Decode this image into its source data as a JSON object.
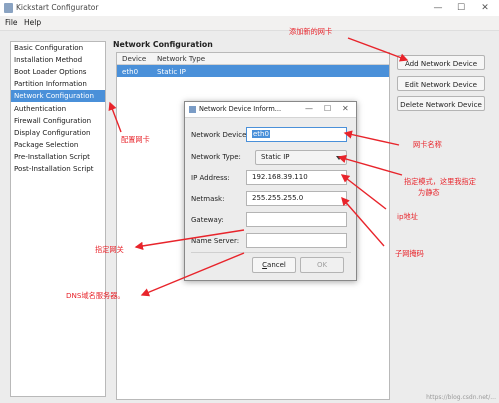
{
  "window": {
    "title": "Kickstart Configurator",
    "min_symbol": "—",
    "max_symbol": "☐",
    "close_symbol": "✕",
    "app_icon": "kickstart-icon"
  },
  "menubar": {
    "items": [
      "File",
      "Help"
    ]
  },
  "sidebar": {
    "items": [
      {
        "label": "Basic Configuration"
      },
      {
        "label": "Installation Method"
      },
      {
        "label": "Boot Loader Options"
      },
      {
        "label": "Partition Information"
      },
      {
        "label": "Network Configuration"
      },
      {
        "label": "Authentication"
      },
      {
        "label": "Firewall Configuration"
      },
      {
        "label": "Display Configuration"
      },
      {
        "label": "Package Selection"
      },
      {
        "label": "Pre-Installation Script"
      },
      {
        "label": "Post-Installation Script"
      }
    ],
    "selected_index": 4
  },
  "network": {
    "section_title": "Network Configuration",
    "columns": [
      "Device",
      "Network Type"
    ],
    "rows": [
      {
        "device": "eth0",
        "type": "Static IP"
      }
    ],
    "buttons": {
      "add": "Add Network Device",
      "edit": "Edit Network Device",
      "delete": "Delete Network Device"
    }
  },
  "dialog": {
    "title": "Network Device Inform...",
    "device_label": "Network Device:",
    "device_value": "eth0",
    "type_label": "Network Type:",
    "type_value": "Static IP",
    "ip_label": "IP Address:",
    "ip_value": "192.168.39.110",
    "netmask_label": "Netmask:",
    "netmask_value": "255.255.255.0",
    "gateway_label": "Gateway:",
    "gateway_value": "",
    "nameserver_label": "Name Server:",
    "nameserver_value": "",
    "cancel_mnemonic": "C",
    "cancel_rest": "ancel",
    "ok_label": "OK",
    "min_symbol": "—",
    "max_symbol": "☐",
    "close_symbol": "✕"
  },
  "annotations": {
    "add_nic": "添加新的网卡",
    "configure_nic": "配置网卡",
    "nic_name": "网卡名称",
    "mode_line1": "指定模式，这里我指定",
    "mode_line2": "为静态",
    "ip": "ip地址",
    "netmask": "子网掩码",
    "gateway": "指定网关",
    "dns": "DNS域名服务器。",
    "color": "#e8242b"
  },
  "watermark": "https://blog.csdn.net/..."
}
